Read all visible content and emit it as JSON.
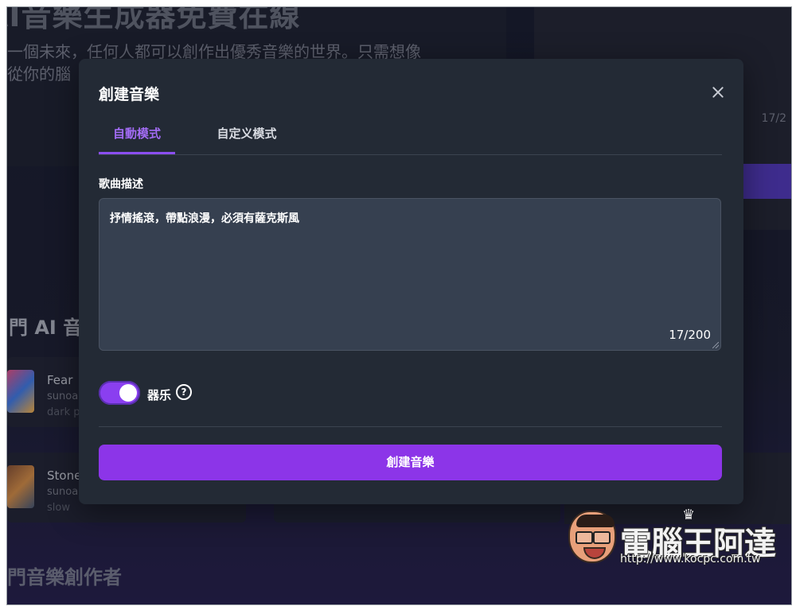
{
  "background": {
    "hero_title": "AI音樂生成器免費在線",
    "hero_text_line1": "一個未來，任何人都可以創作出優秀音樂的世界。只需想像",
    "hero_text_line2": "從你的腦",
    "right_counter": "17/2",
    "section_popular": "門 AI 音樂",
    "section_creators": "門音樂創作者",
    "songs": [
      {
        "title": "Fear",
        "artist": "sunoa",
        "tag": "dark p"
      },
      {
        "title": "Stone",
        "artist": "sunoa",
        "tag": "slow"
      }
    ]
  },
  "modal": {
    "title": "創建音樂",
    "tabs": [
      {
        "label": "自動模式",
        "active": true
      },
      {
        "label": "自定义模式",
        "active": false
      }
    ],
    "description_label": "歌曲描述",
    "description_value": "抒情搖滾，帶點浪漫，必須有薩克斯風",
    "char_count": "17/200",
    "instrumental": {
      "label": "器乐",
      "enabled": true
    },
    "help_glyph": "?",
    "submit_label": "創建音樂"
  },
  "watermark": {
    "name": "電腦王阿達",
    "url": "http://www.kocpc.com.tw",
    "crown_glyph": "♛"
  },
  "colors": {
    "accent": "#8c35e8",
    "tab_active": "#a36cf5",
    "modal_bg": "#232a35",
    "textarea_bg": "#364050"
  }
}
